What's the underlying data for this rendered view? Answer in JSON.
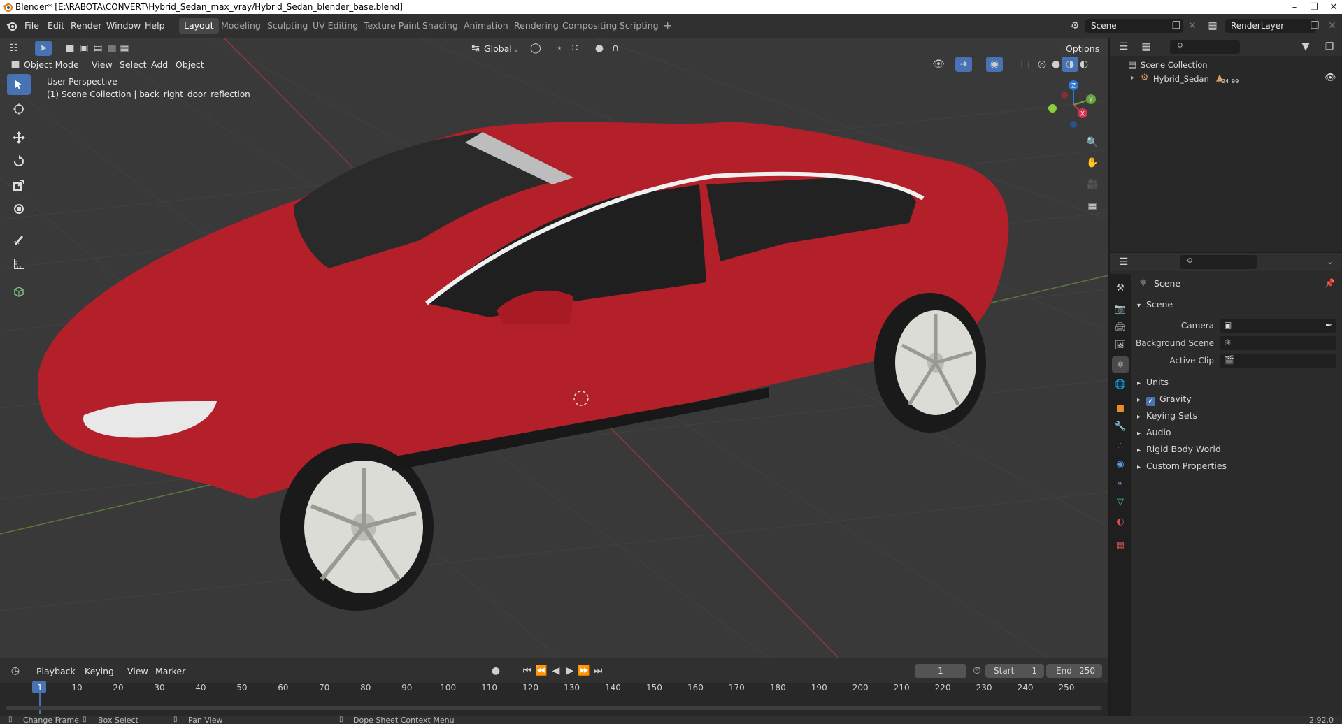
{
  "window": {
    "title": "Blender* [E:\\RABOTA\\CONVERT\\Hybrid_Sedan_max_vray/Hybrid_Sedan_blender_base.blend]"
  },
  "menu": [
    "File",
    "Edit",
    "Render",
    "Window",
    "Help"
  ],
  "workspaces": [
    "Layout",
    "Modeling",
    "Sculpting",
    "UV Editing",
    "Texture Paint",
    "Shading",
    "Animation",
    "Rendering",
    "Compositing",
    "Scripting"
  ],
  "active_workspace": "Layout",
  "scene_field": "Scene",
  "render_layer": "RenderLayer",
  "viewport": {
    "mode": "Object Mode",
    "menus": [
      "View",
      "Select",
      "Add",
      "Object"
    ],
    "transform_orientation": "Global",
    "options_label": "Options",
    "overlay_line1": "User Perspective",
    "overlay_line2": "(1) Scene Collection | back_right_door_reflection"
  },
  "gizmo_axes": {
    "z": "Z",
    "y": "Y",
    "x": "X"
  },
  "outliner": {
    "root": "Scene Collection",
    "items": [
      {
        "name": "Hybrid_Sedan",
        "badge1": "24",
        "badge2": "99"
      }
    ]
  },
  "properties": {
    "context": "Scene",
    "panel_title": "Scene",
    "fields": [
      {
        "label": "Camera"
      },
      {
        "label": "Background Scene"
      },
      {
        "label": "Active Clip"
      }
    ],
    "subpanels": [
      "Units",
      "Gravity",
      "Keying Sets",
      "Audio",
      "Rigid Body World",
      "Custom Properties"
    ],
    "gravity_checked": true
  },
  "timeline": {
    "menus": [
      "Playback",
      "Keying",
      "View",
      "Marker"
    ],
    "current_frame": "1",
    "start_label": "Start",
    "start": "1",
    "end_label": "End",
    "end": "250",
    "ruler": [
      "1",
      "10",
      "20",
      "30",
      "40",
      "50",
      "60",
      "70",
      "80",
      "90",
      "100",
      "110",
      "120",
      "130",
      "140",
      "150",
      "160",
      "170",
      "180",
      "190",
      "200",
      "210",
      "220",
      "230",
      "240",
      "250"
    ]
  },
  "statusbar": {
    "items": [
      "Change Frame",
      "Box Select",
      "Pan View",
      "Dope Sheet Context Menu"
    ],
    "version": "2.92.0"
  },
  "colors": {
    "accent": "#4772b3",
    "car_body": "#b3202a",
    "viewport_bg": "#393939"
  }
}
